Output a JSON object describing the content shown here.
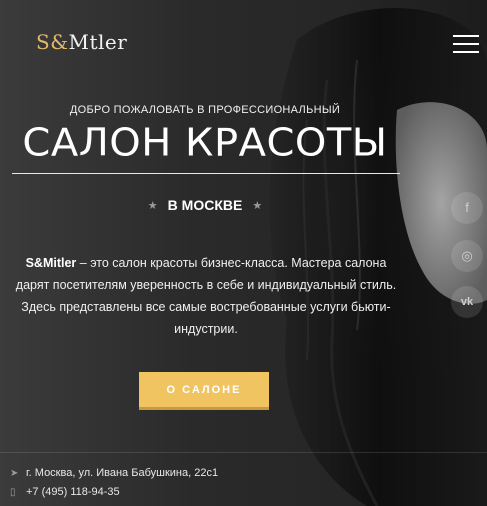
{
  "brand": {
    "logo_first": "S",
    "logo_amp": "&",
    "logo_rest": "Mtler"
  },
  "hero": {
    "welcome": "ДОБРО ПОЖАЛОВАТЬ В ПРОФЕССИОНАЛЬНЫЙ",
    "title": "САЛОН КРАСОТЫ",
    "city": "В МОСКВЕ",
    "desc_brand": "S&Mitler",
    "desc_text": " – это салон красоты бизнес-класса. Мастера салона дарят посетителям уверенность в себе и индивидуальный стиль. Здесь представлены все самые востребованные услуги бьюти-индустрии.",
    "cta_label": "О САЛОНЕ"
  },
  "social": {
    "facebook": "f",
    "instagram": "◎",
    "vk": "vk"
  },
  "footer": {
    "address": "г. Москва, ул. Ивана Бабушкина, 22с1",
    "phone": "+7 (495) 118-94-35"
  },
  "colors": {
    "accent": "#f1c462",
    "logo_accent": "#e2b96a"
  },
  "icons": [
    "hamburger-menu-icon",
    "star-icon",
    "facebook-icon",
    "instagram-icon",
    "vk-icon",
    "location-arrow-icon",
    "phone-icon"
  ]
}
